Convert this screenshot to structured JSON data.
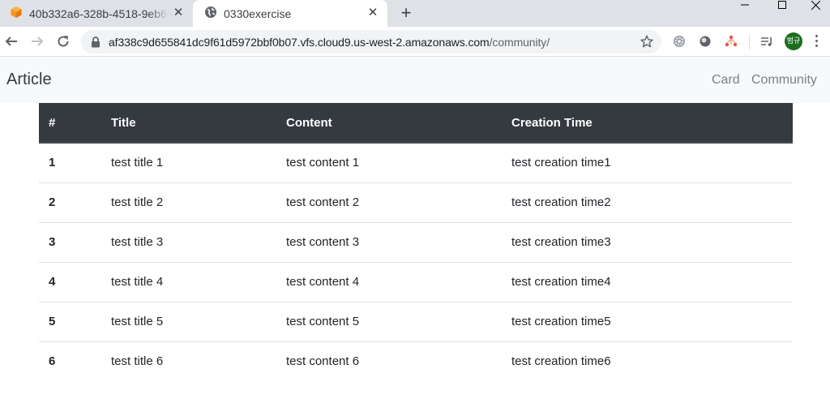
{
  "browser": {
    "tabs": [
      {
        "title": "40b332a6-328b-4518-9eb6",
        "icon": "orange-cube-icon",
        "active": false
      },
      {
        "title": "0330exercise",
        "icon": "globe-icon",
        "active": true
      }
    ],
    "url_host": "af338c9d655841dc9f61d5972bbf0b07.vfs.cloud9.us-west-2.amazonaws.com",
    "url_path": "/community/",
    "profile_label": "범규",
    "colors": {
      "tabstrip": "#dee1e6",
      "profile": "#1b6e1e"
    }
  },
  "navbar": {
    "brand": "Article",
    "links": [
      "Card",
      "Community"
    ]
  },
  "table": {
    "headers": [
      "#",
      "Title",
      "Content",
      "Creation Time"
    ],
    "rows": [
      {
        "num": "1",
        "title": "test title 1",
        "content": "test content 1",
        "time": "test creation time1"
      },
      {
        "num": "2",
        "title": "test title 2",
        "content": "test content 2",
        "time": "test creation time2"
      },
      {
        "num": "3",
        "title": "test title 3",
        "content": "test content 3",
        "time": "test creation time3"
      },
      {
        "num": "4",
        "title": "test title 4",
        "content": "test content 4",
        "time": "test creation time4"
      },
      {
        "num": "5",
        "title": "test title 5",
        "content": "test content 5",
        "time": "test creation time5"
      },
      {
        "num": "6",
        "title": "test title 6",
        "content": "test content 6",
        "time": "test creation time6"
      }
    ],
    "colors": {
      "header_bg": "#343a40",
      "header_text": "#ffffff"
    }
  }
}
